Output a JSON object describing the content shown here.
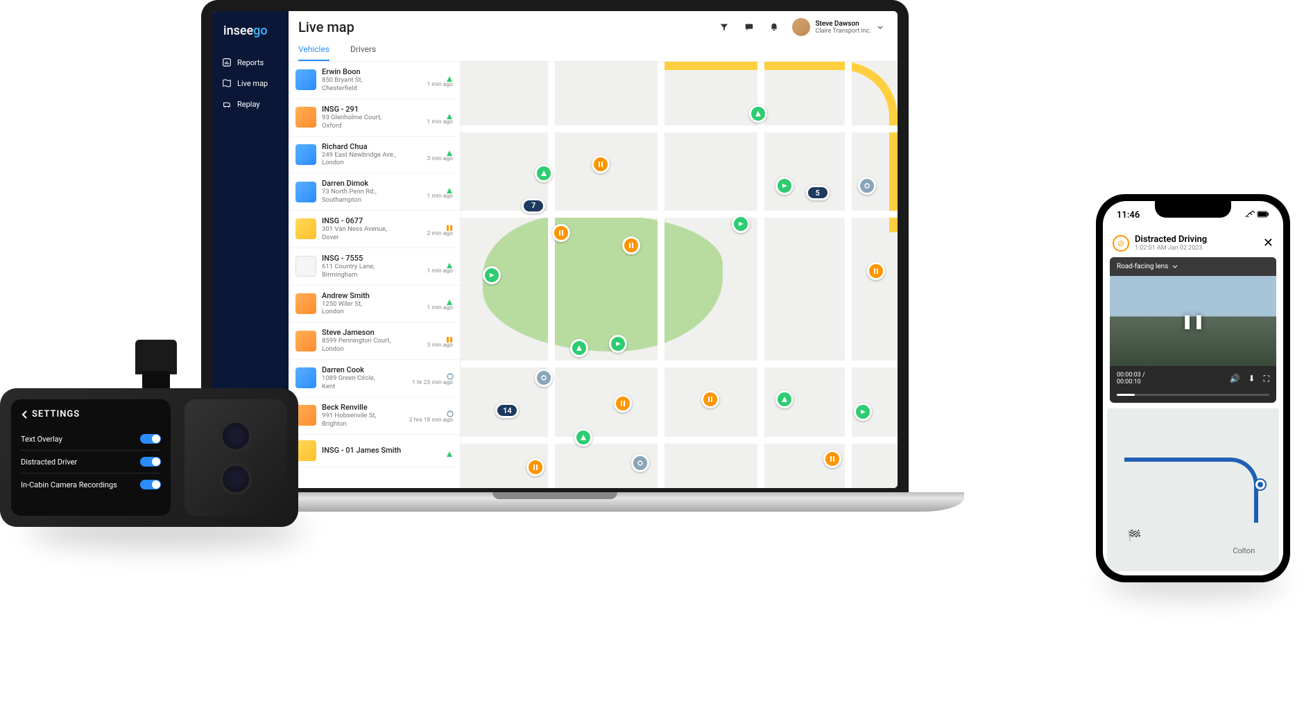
{
  "brand": {
    "part1": "insee",
    "part2": "go"
  },
  "nav": {
    "reports": "Reports",
    "livemap": "Live map",
    "replay": "Replay"
  },
  "header": {
    "title": "Live map",
    "user_name": "Steve Dawson",
    "user_company": "Claire Transport Inc."
  },
  "tabs": {
    "vehicles": "Vehicles",
    "drivers": "Drivers"
  },
  "vehicles": [
    {
      "name": "Erwin Boon",
      "addr1": "850 Bryant St,",
      "addr2": "Chesterfield",
      "time": "1 min ago",
      "status": "moving",
      "thumb": "blue"
    },
    {
      "name": "INSG - 291",
      "addr1": "93 Glenholme Court,",
      "addr2": "Oxford",
      "time": "1 min ago",
      "status": "moving",
      "thumb": "orange"
    },
    {
      "name": "Richard Chua",
      "addr1": "249 East Newbridge Ave.,",
      "addr2": "London",
      "time": "3 min ago",
      "status": "moving",
      "thumb": "blue"
    },
    {
      "name": "Darren Dimok",
      "addr1": "73 North Penn Rd.,",
      "addr2": "Southampton",
      "time": "1 min ago",
      "status": "moving",
      "thumb": "blue"
    },
    {
      "name": "INSG - 0677",
      "addr1": "301 Van Ness Avenue,",
      "addr2": "Dover",
      "time": "2 min ago",
      "status": "paused",
      "thumb": "yellow"
    },
    {
      "name": "INSG - 7555",
      "addr1": "611 Country Lane,",
      "addr2": "Birmingham",
      "time": "1 min ago",
      "status": "moving",
      "thumb": "white"
    },
    {
      "name": "Andrew Smith",
      "addr1": "1250 Wiler St,",
      "addr2": "London",
      "time": "1 min ago",
      "status": "moving",
      "thumb": "orange"
    },
    {
      "name": "Steve Jameson",
      "addr1": "8599 Pennington Court,",
      "addr2": "London",
      "time": "3 min ago",
      "status": "paused",
      "thumb": "orange"
    },
    {
      "name": "Darren Cook",
      "addr1": "1089 Green Circle,",
      "addr2": "Kent",
      "time": "1 hr 23 min ago",
      "status": "off",
      "thumb": "blue"
    },
    {
      "name": "Beck Renville",
      "addr1": "991 Hobsenvile St,",
      "addr2": "Brighton",
      "time": "2 hrs 18 min ago",
      "status": "off",
      "thumb": "orange"
    },
    {
      "name": "INSG - 01    James Smith",
      "addr1": "",
      "addr2": "",
      "time": "",
      "status": "moving",
      "thumb": "yellow"
    }
  ],
  "map_clusters": {
    "c1": "7",
    "c2": "14",
    "c3": "5"
  },
  "dashcam": {
    "header": "SETTINGS",
    "row1": "Text Overlay",
    "row2": "Distracted Driver",
    "row3": "In-Cabin Camera Recordings"
  },
  "phone": {
    "time": "11:46",
    "title": "Distracted Driving",
    "subtitle": "1:02:01 AM Jan 02 2023",
    "lens_selector": "Road-facing lens",
    "clip_now": "00:00:03 /",
    "clip_total": "00:00:10",
    "map_label": "Colton"
  }
}
